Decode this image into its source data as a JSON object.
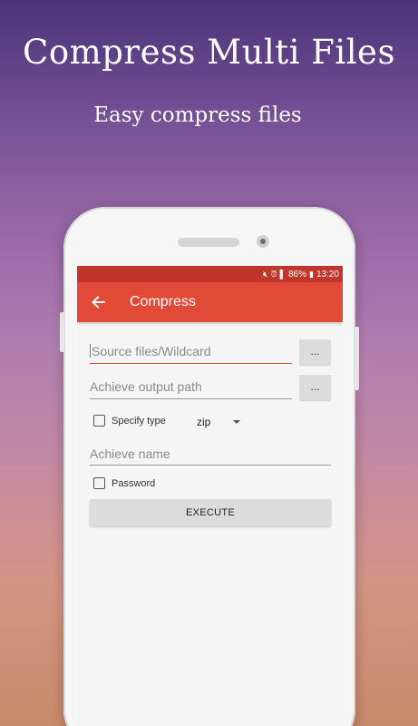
{
  "promo": {
    "headline": "Compress Multi Files",
    "subline": "Easy compress files"
  },
  "status_bar": {
    "icons": [
      "mute-icon",
      "alarm-icon",
      "wifi-signal-icon",
      "battery-icon"
    ],
    "battery": "86%",
    "time": "13:20",
    "color": "#c0362c"
  },
  "toolbar": {
    "title": "Compress",
    "color": "#e04a37"
  },
  "form": {
    "source_placeholder": "Source files/Wildcard",
    "source_browse_label": "...",
    "output_placeholder": "Achieve output path",
    "output_browse_label": "...",
    "specify_type_label": "Specify type",
    "specify_type_checked": false,
    "type_value": "zip",
    "name_placeholder": "Achieve name",
    "password_label": "Password",
    "password_checked": false,
    "execute_label": "EXECUTE"
  }
}
